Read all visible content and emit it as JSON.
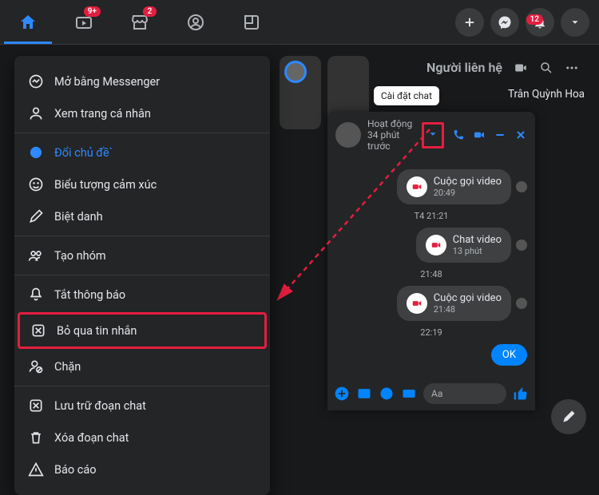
{
  "topbar": {
    "badges": {
      "watch": "9+",
      "market": "2",
      "notif": "12"
    }
  },
  "tooltip": "Cài đặt chat",
  "contacts": {
    "title": "Người liên hệ",
    "contact_name": "Trân Quỳnh Hoa"
  },
  "menu": {
    "open_messenger": "Mở bằng Messenger",
    "view_profile": "Xem trang cá nhân",
    "change_theme": "Đổi chủ đề`",
    "emoji": "Biểu tượng cảm xúc",
    "nickname": "Biệt danh",
    "create_group": "Tạo nhóm",
    "mute": "Tắt thông báo",
    "ignore": "Bỏ qua tin nhắn",
    "block": "Chặn",
    "archive": "Lưu trữ đoạn chat",
    "delete": "Xóa đoạn chat",
    "report": "Báo cáo"
  },
  "chat": {
    "status": "Hoạt động 34 phút trước",
    "ts1": "T4 21:21",
    "ts2": "21:48",
    "ts3": "22:19",
    "msg1": {
      "title": "Cuộc gọi video",
      "sub": "20:49"
    },
    "msg2": {
      "title": "Chat video",
      "sub": "13 phút"
    },
    "msg3": {
      "title": "Cuộc gọi video",
      "sub": "21:48"
    },
    "ok": "OK",
    "placeholder": "Aa"
  }
}
